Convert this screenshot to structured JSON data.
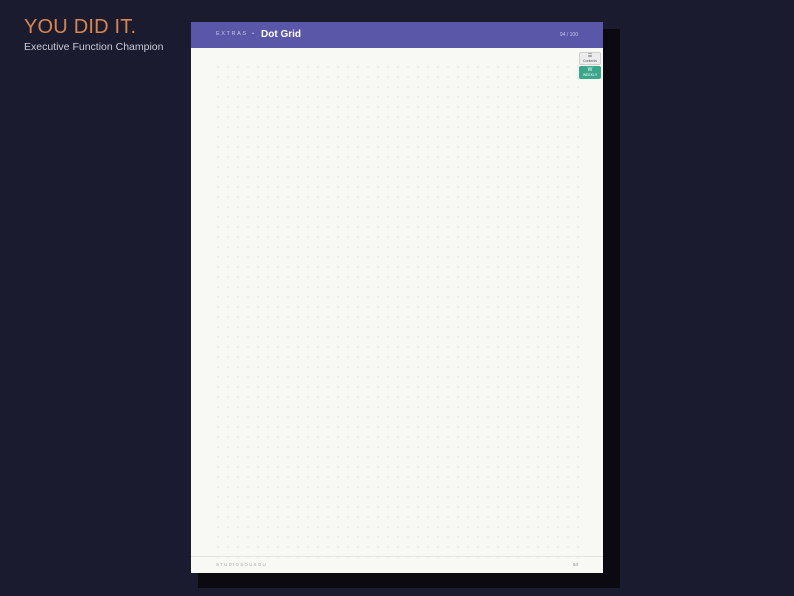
{
  "hero": {
    "title": "YOU DID IT.",
    "subtitle": "Executive Function Champion"
  },
  "page": {
    "header": {
      "section": "EXTRAS",
      "separator": "•",
      "title": "Dot Grid",
      "count": "94 / 100"
    },
    "side_tabs": [
      {
        "icon": "☰",
        "label": "Contents"
      },
      {
        "icon": "W",
        "label": "WEEKLY"
      }
    ],
    "footer": {
      "brand": "STUDIOSOUSOU",
      "page_number": "94"
    }
  },
  "colors": {
    "background": "#1b1b2f",
    "accent": "#d8864e",
    "header": "#5b57a8",
    "tab_green": "#3aa68a"
  }
}
